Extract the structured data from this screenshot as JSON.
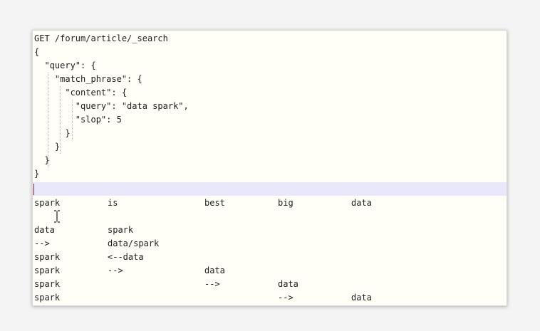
{
  "editor": {
    "code_lines": [
      "GET /forum/article/_search",
      "{",
      "  \"query\": {",
      "    \"match_phrase\": {",
      "      \"content\": {",
      "        \"query\": \"data spark\",",
      "        \"slop\": 5",
      "      }",
      "    }",
      "  }",
      "}"
    ],
    "empty_line": "",
    "table_rows": [
      [
        "spark",
        "is",
        "best",
        "big",
        "data"
      ],
      [
        "",
        "",
        "",
        "",
        ""
      ],
      [
        "data",
        "spark",
        "",
        "",
        ""
      ],
      [
        "-->",
        "data/spark",
        "",
        "",
        ""
      ],
      [
        "spark",
        "<--data",
        "",
        "",
        ""
      ],
      [
        "spark",
        "-->",
        "data",
        "",
        ""
      ],
      [
        "spark",
        "",
        "-->",
        "data",
        ""
      ],
      [
        "spark",
        "",
        "",
        "-->",
        "data"
      ]
    ]
  },
  "colors": {
    "editor_background": "#fffef7",
    "current_line_highlight": "#e8e8fa",
    "caret": "#8a1f3c",
    "page_background": "#f4f4f4"
  },
  "icons": {
    "mouse_cursor": "text-ibeam-cursor-icon"
  }
}
